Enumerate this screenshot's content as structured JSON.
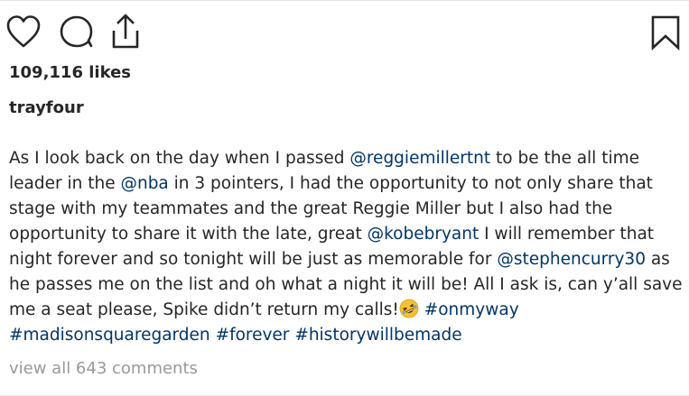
{
  "post": {
    "likes_text": "109,116 likes",
    "username": "trayfour",
    "caption": {
      "t1": "As I look back on the day when I passed ",
      "m1": "@reggiemillertnt",
      "t2": " to be the all time leader in the ",
      "m2": "@nba",
      "t3": " in 3 pointers, I had the opportunity to not only share that stage with my teammates and the great Reggie Miller but I also had the opportunity to share it with the late, great ",
      "m3": "@kobebryant",
      "t4": " I will remember that night forever and so tonight will be just as memorable for ",
      "m4": "@stephencurry30",
      "t5": " as he passes me on the list and oh what a night it will be! All I ask is, can y’all save me a seat please, Spike didn’t return my calls!",
      "emoji": "rolling-on-floor-laughing-emoji",
      "h1": "#onmyway",
      "h2": "#madisonsquaregarden",
      "h3": "#forever",
      "h4": "#historywillbemade"
    },
    "view_comments": "view all 643 comments"
  },
  "icons": {
    "like": "heart-icon",
    "comment": "comment-icon",
    "share": "share-icon",
    "save": "bookmark-icon"
  },
  "colors": {
    "text": "#262626",
    "link": "#003569",
    "muted": "#999999"
  }
}
